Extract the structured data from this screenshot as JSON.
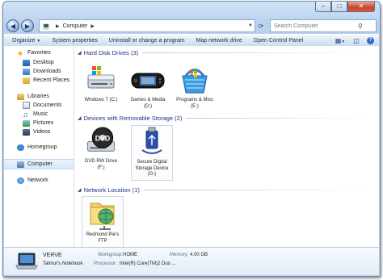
{
  "address": {
    "path": [
      "Computer"
    ]
  },
  "search": {
    "placeholder": "Search Computer"
  },
  "commands": {
    "organize": "Organize",
    "system_properties": "System properties",
    "uninstall": "Uninstall or change a program",
    "map_drive": "Map network drive",
    "control_panel": "Open Control Panel"
  },
  "nav": {
    "favorites": "Favorites",
    "desktop": "Desktop",
    "downloads": "Downloads",
    "recent": "Recent Places",
    "libraries": "Libraries",
    "documents": "Documents",
    "music": "Music",
    "pictures": "Pictures",
    "videos": "Videos",
    "homegroup": "Homegroup",
    "computer": "Computer",
    "network": "Network"
  },
  "groups": {
    "hdd": "Hard Disk Drives (3)",
    "removable": "Devices with Removable Storage (2)",
    "network": "Network Location (1)"
  },
  "drives": {
    "c": {
      "line1": "Windows 7 (C:)",
      "line2": ""
    },
    "d": {
      "line1": "Games & Media",
      "line2": "(D:)"
    },
    "e": {
      "line1": "Programs & Misc",
      "line2": "(E:)"
    },
    "f": {
      "line1": "DVD RW Drive (F:)",
      "line2": ""
    },
    "g": {
      "line1": "Secure Digital",
      "line2": "Storage Device",
      "line3": "(G:)"
    },
    "ftp": {
      "line1": "Redmond Pie's",
      "line2": "FTP"
    }
  },
  "details": {
    "name": "VERVE",
    "subtitle": "Taimur's Notebook",
    "workgroup_label": "Workgroup:",
    "workgroup": "HOME",
    "memory_label": "Memory:",
    "memory": "4.00 GB",
    "processor_label": "Processor:",
    "processor": "Intel(R) Core(TM)2 Duo ..."
  },
  "icons": {
    "computer_breadcrumb": "computer-icon",
    "favorites": "star-icon",
    "homegroup": "homegroup-icon",
    "network": "network-icon"
  },
  "colors": {
    "accent": "#1e3287",
    "frame": "#b9d1ee",
    "close": "#c9452a"
  }
}
